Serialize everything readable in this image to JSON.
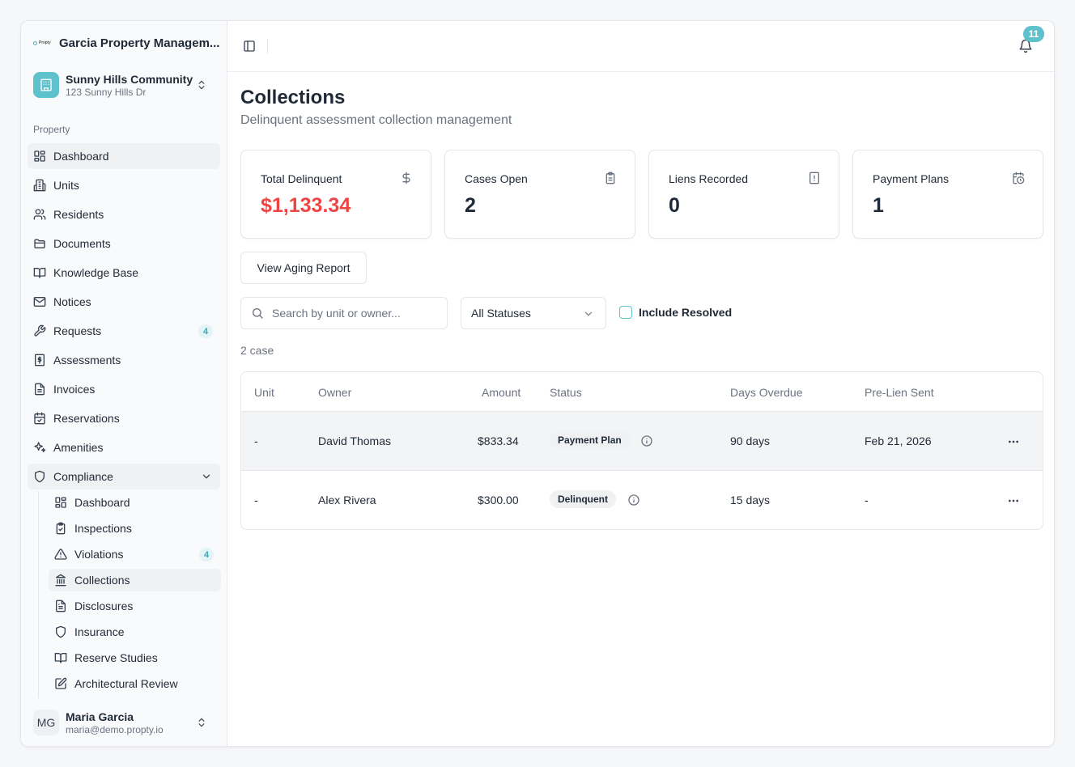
{
  "brand": {
    "logo_text": "Propty",
    "name": "Garcia Property Managem..."
  },
  "community": {
    "name": "Sunny Hills Community",
    "address": "123 Sunny Hills Dr"
  },
  "sidebar": {
    "section_label": "Property",
    "items": [
      {
        "label": "Dashboard",
        "icon": "dashboard-icon"
      },
      {
        "label": "Units",
        "icon": "building-icon"
      },
      {
        "label": "Residents",
        "icon": "users-icon"
      },
      {
        "label": "Documents",
        "icon": "folder-icon"
      },
      {
        "label": "Knowledge Base",
        "icon": "book-icon"
      },
      {
        "label": "Notices",
        "icon": "mail-icon"
      },
      {
        "label": "Requests",
        "icon": "wrench-icon",
        "badge": "4"
      },
      {
        "label": "Assessments",
        "icon": "dollar-receipt-icon"
      },
      {
        "label": "Invoices",
        "icon": "file-icon"
      },
      {
        "label": "Reservations",
        "icon": "calendar-check-icon"
      },
      {
        "label": "Amenities",
        "icon": "sparkles-icon"
      },
      {
        "label": "Compliance",
        "icon": "shield-icon"
      }
    ],
    "compliance_items": [
      {
        "label": "Dashboard",
        "icon": "dashboard-icon"
      },
      {
        "label": "Inspections",
        "icon": "clipboard-check-icon"
      },
      {
        "label": "Violations",
        "icon": "warning-icon",
        "badge": "4"
      },
      {
        "label": "Collections",
        "icon": "bank-icon"
      },
      {
        "label": "Disclosures",
        "icon": "file-text-icon"
      },
      {
        "label": "Insurance",
        "icon": "shield-icon"
      },
      {
        "label": "Reserve Studies",
        "icon": "book-icon"
      },
      {
        "label": "Architectural Review",
        "icon": "edit-icon"
      }
    ]
  },
  "user": {
    "initials": "MG",
    "name": "Maria Garcia",
    "email": "maria@demo.propty.io"
  },
  "topbar": {
    "notification_count": "11"
  },
  "page": {
    "title": "Collections",
    "subtitle": "Delinquent assessment collection management"
  },
  "stats": [
    {
      "label": "Total Delinquent",
      "value": "$1,133.34",
      "icon": "dollar-icon",
      "color": "#ef4444"
    },
    {
      "label": "Cases Open",
      "value": "2",
      "icon": "clipboard-icon"
    },
    {
      "label": "Liens Recorded",
      "value": "0",
      "icon": "file-alert-icon"
    },
    {
      "label": "Payment Plans",
      "value": "1",
      "icon": "calendar-clock-icon"
    }
  ],
  "actions": {
    "aging_report": "View Aging Report"
  },
  "filters": {
    "search_placeholder": "Search by unit or owner...",
    "status_selected": "All Statuses",
    "include_resolved": "Include Resolved"
  },
  "case_count": "2 case",
  "table": {
    "columns": [
      "Unit",
      "Owner",
      "Amount",
      "Status",
      "Days Overdue",
      "Pre-Lien Sent"
    ],
    "rows": [
      {
        "unit": "-",
        "owner": "David Thomas",
        "amount": "$833.34",
        "status": "Payment Plan",
        "days": "90 days",
        "prelien": "Feb 21, 2026"
      },
      {
        "unit": "-",
        "owner": "Alex Rivera",
        "amount": "$300.00",
        "status": "Delinquent",
        "days": "15 days",
        "prelien": "-"
      }
    ]
  },
  "colors": {
    "accent": "#5fc1cc",
    "danger": "#ef4444"
  }
}
